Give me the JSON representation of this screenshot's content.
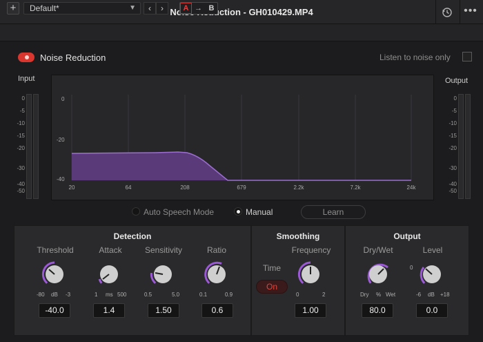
{
  "titlebar": {
    "title": "Noise Reduction - GH010429.MP4",
    "close_icon": "×",
    "more_icon": "•••"
  },
  "preset_bar": {
    "add_label": "+",
    "preset": "Default*",
    "prev_label": "‹",
    "next_label": "›",
    "a_label": "A",
    "copy_label": "→",
    "b_label": "B"
  },
  "controls": {
    "noise_reduction_label": "Noise Reduction",
    "noise_reduction_on": true,
    "listen_label": "Listen to noise only",
    "listen_checked": false,
    "auto_speech_label": "Auto Speech Mode",
    "manual_label": "Manual",
    "mode": "Manual",
    "learn_label": "Learn"
  },
  "meters": {
    "input_label": "Input",
    "output_label": "Output",
    "ticks": [
      "0",
      "-5",
      "-10",
      "-15",
      "-20",
      "-30",
      "-40",
      "-50"
    ]
  },
  "graph": {
    "x_ticks": [
      "20",
      "64",
      "208",
      "679",
      "2.2k",
      "7.2k",
      "24k"
    ],
    "y_ticks": [
      "0",
      "-20",
      "-40"
    ],
    "fill_color": "#5a3a78",
    "line_color": "#9c6fd0"
  },
  "detection": {
    "title": "Detection",
    "threshold": {
      "label": "Threshold",
      "min": "-80",
      "unit": "dB",
      "max": "-3",
      "value": "-40.0"
    },
    "attack": {
      "label": "Attack",
      "min": "1",
      "unit": "ms",
      "max": "500",
      "value": "1.4"
    },
    "sensitivity": {
      "label": "Sensitivity",
      "min": "0.5",
      "max": "5.0",
      "value": "1.50"
    },
    "ratio": {
      "label": "Ratio",
      "min": "0.1",
      "max": "0.9",
      "value": "0.6"
    }
  },
  "smoothing": {
    "title": "Smoothing",
    "time_label": "Time",
    "time_button": "On",
    "frequency": {
      "label": "Frequency",
      "min": "0",
      "max": "2",
      "value": "1.00"
    }
  },
  "output": {
    "title": "Output",
    "drywet": {
      "label": "Dry/Wet",
      "min": "Dry",
      "unit": "%",
      "max": "Wet",
      "value": "80.0"
    },
    "level": {
      "label": "Level",
      "zero": "0",
      "min": "-6",
      "unit": "dB",
      "max": "+18",
      "value": "0.0"
    }
  },
  "colors": {
    "accent_red": "#d8362e",
    "knob_ring": "#9b59d6",
    "panel_bg": "#2a2a2c"
  }
}
